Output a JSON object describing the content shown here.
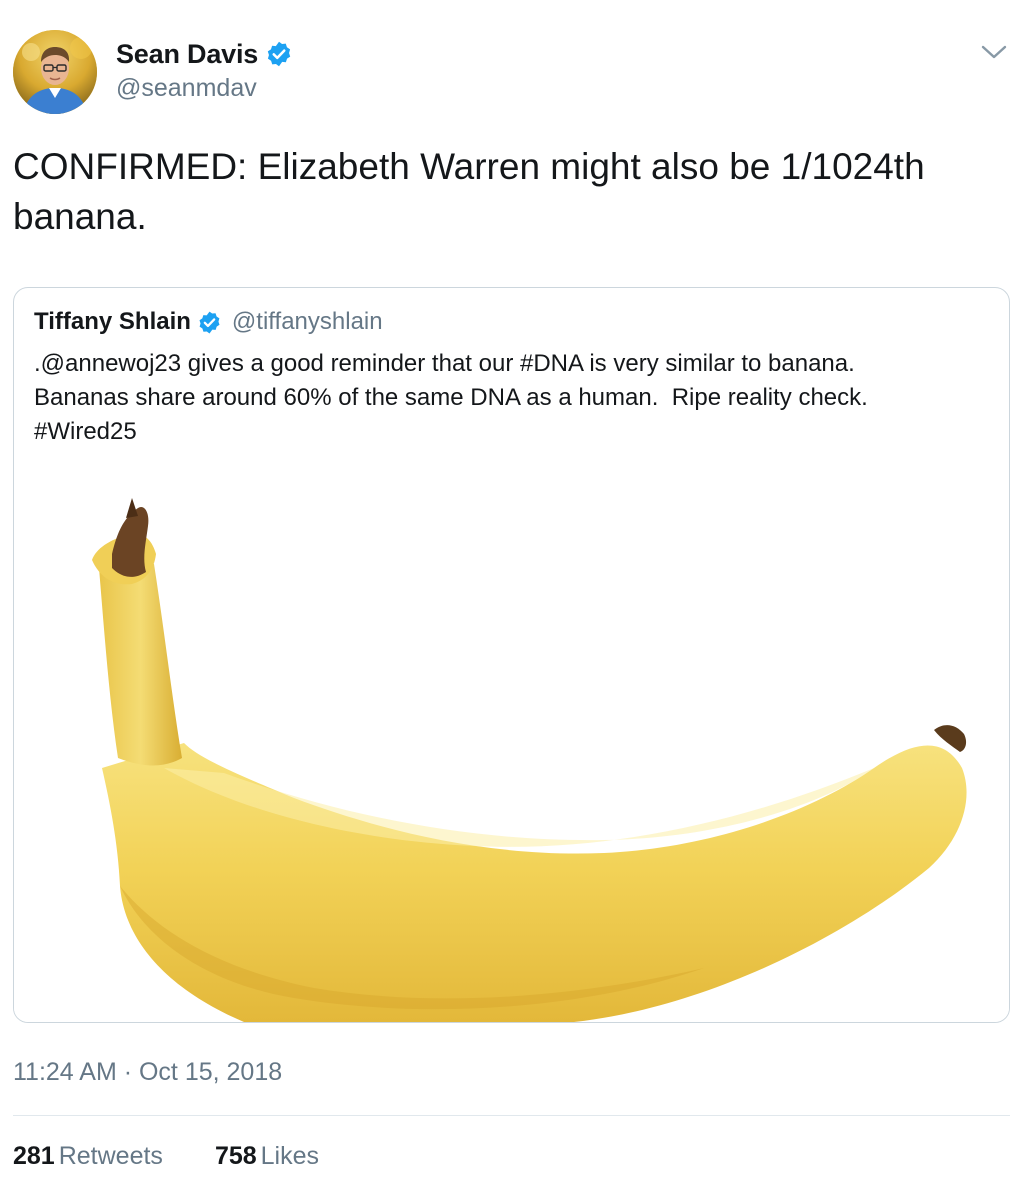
{
  "tweet": {
    "author_name": "Sean Davis",
    "author_handle": "@seanmdav",
    "text_lines": [
      "CONFIRMED: Elizabeth Warren might also be 1/1024th",
      "banana."
    ],
    "timestamp": "11:24 AM · Oct 15, 2018",
    "retweets_count": "281",
    "retweets_label": "Retweets",
    "likes_count": "758",
    "likes_label": "Likes"
  },
  "quoted_tweet": {
    "author_name": "Tiffany Shlain",
    "author_handle": "@tiffanyshlain",
    "text_lines": [
      ".@annewoj23 gives a good reminder that our #DNA is very similar to banana.",
      "Bananas share around 60% of the same DNA as a human.  Ripe reality check.",
      "#Wired25"
    ]
  },
  "icons": {
    "verified": "verified-badge-icon",
    "caret": "chevron-down-icon"
  },
  "colors": {
    "verified_blue": "#1da1f2",
    "secondary_text": "#657786",
    "primary_text": "#14171a",
    "border": "#ccd6dd",
    "banana_yellow": "#f3d25c"
  }
}
